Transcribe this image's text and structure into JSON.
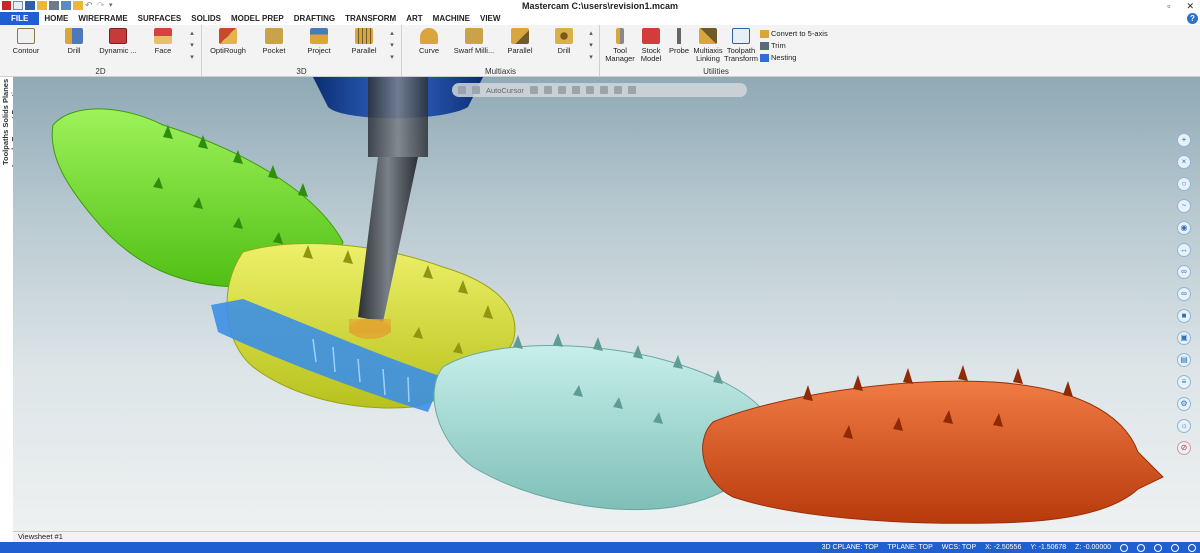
{
  "window": {
    "title": "Mastercam C:\\users\\revision1.mcam",
    "controls": [
      "▫",
      "✕"
    ]
  },
  "menu": [
    "FILE",
    "HOME",
    "WIREFRAME",
    "SURFACES",
    "SOLIDS",
    "MODEL PREP",
    "DRAFTING",
    "TRANSFORM",
    "ART",
    "MACHINE",
    "VIEW"
  ],
  "help_label": "?",
  "ribbon": {
    "group_2d": {
      "label": "2D",
      "buttons": [
        "Contour",
        "Drill",
        "Dynamic ...",
        "Face"
      ]
    },
    "group_3d": {
      "label": "3D",
      "buttons": [
        "OptiRough",
        "Pocket",
        "Project",
        "Parallel"
      ]
    },
    "group_multiaxis": {
      "label": "Multiaxis",
      "buttons": [
        "Curve",
        "Swarf Milli...",
        "Parallel",
        "Drill"
      ]
    },
    "group_utilities": {
      "label": "Utilities",
      "buttons": [
        "Tool Manager",
        "Stock Model",
        "Probe",
        "Multiaxis Linking",
        "Toolpath Transform"
      ],
      "small": [
        "Convert to 5-axis",
        "Trim",
        "Nesting"
      ]
    }
  },
  "side_tabs": "Toolpaths Solids Planes Levels Recent Functions Art",
  "float_toolbar": {
    "autocursor": "AutoCursor"
  },
  "viewsheet": "Viewsheet #1",
  "status": {
    "cplane": "3D CPLANE: TOP",
    "tplane": "TPLANE: TOP",
    "wcs": "WCS: TOP",
    "x_label": "X:",
    "x": "-2.50556",
    "y_label": "Y:",
    "y": "-1.50678",
    "z_label": "Z:",
    "z": "-0.00000"
  },
  "colors": {
    "accent": "#1f5fcf",
    "part_green": "#7bdc2a",
    "part_yellow": "#d9e23a",
    "part_teal": "#9fd8d2",
    "part_orange": "#e0521b",
    "toolpath_blue": "#3c8fe6"
  }
}
